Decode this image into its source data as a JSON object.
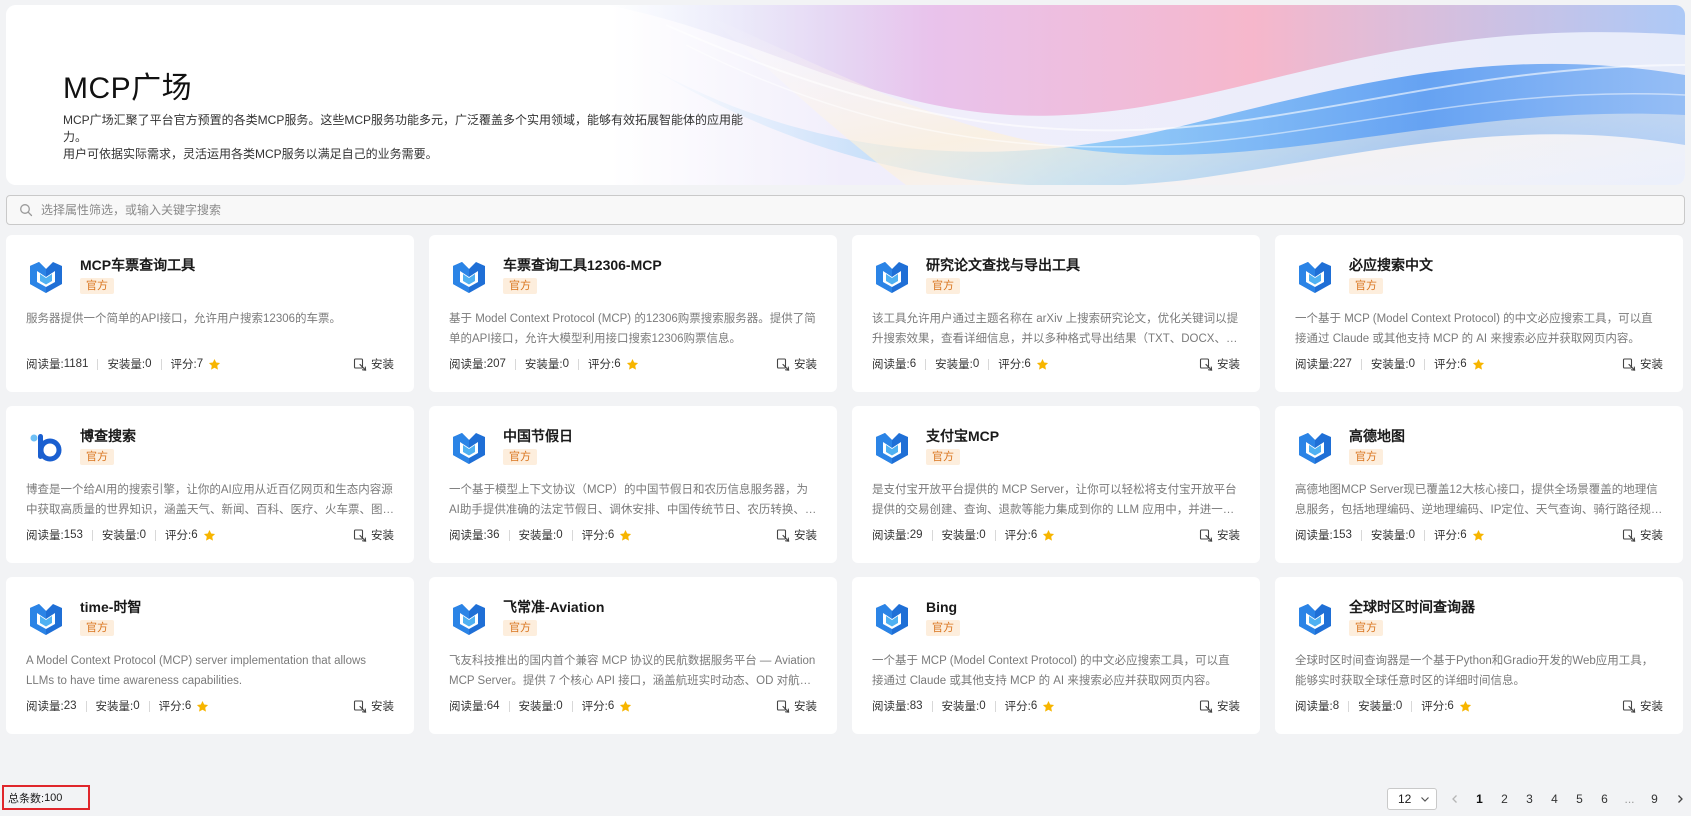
{
  "banner": {
    "title": "MCP广场",
    "desc_line1": "MCP广场汇聚了平台官方预置的各类MCP服务。这些MCP服务功能多元，广泛覆盖多个实用领域，能够有效拓展智能体的应用能力。",
    "desc_line2": "用户可依据实际需求，灵活运用各类MCP服务以满足自己的业务需要。"
  },
  "search": {
    "placeholder": "选择属性筛选，或输入关键字搜索",
    "icon": "search-icon"
  },
  "labels": {
    "reads": "阅读量: ",
    "installs": "安装量: ",
    "rating": "评分: ",
    "install_button": "安装",
    "official_badge": "官方"
  },
  "colors": {
    "badge_bg": "#fdeedd",
    "badge_text": "#d9741d",
    "logo_blue": "#1f6fd6",
    "logo_light": "#4fb1f2",
    "star": "#f7b500",
    "total_border": "#e0262b"
  },
  "cards": [
    {
      "name": "MCP车票查询工具",
      "badge": "官方",
      "logo": "mcp-logo-icon",
      "desc": "服务器提供一个简单的API接口，允许用户搜索12306的车票。",
      "reads": "1181",
      "installs": "0",
      "rating": "7"
    },
    {
      "name": "车票查询工具12306-MCP",
      "badge": "官方",
      "logo": "mcp-logo-icon",
      "desc": "基于 Model Context Protocol (MCP) 的12306购票搜索服务器。提供了简单的API接口，允许大模型利用接口搜索12306购票信息。",
      "reads": "207",
      "installs": "0",
      "rating": "6"
    },
    {
      "name": "研究论文查找与导出工具",
      "badge": "官方",
      "logo": "mcp-logo-icon",
      "desc": "该工具允许用户通过主题名称在 arXiv 上搜索研究论文，优化关键词以提升搜索效果，查看详细信息，并以多种格式导出结果（TXT、DOCX、PDF、...",
      "reads": "6",
      "installs": "0",
      "rating": "6"
    },
    {
      "name": "必应搜索中文",
      "badge": "官方",
      "logo": "mcp-logo-icon",
      "desc": "一个基于 MCP (Model Context Protocol) 的中文必应搜索工具，可以直接通过 Claude 或其他支持 MCP 的 AI 来搜索必应并获取网页内容。",
      "reads": "227",
      "installs": "0",
      "rating": "6"
    },
    {
      "name": "博查搜索",
      "badge": "官方",
      "logo": "bocha-logo-icon",
      "desc": "博查是一个给AI用的搜索引擎，让你的AI应用从近百亿网页和生态内容源中获取高质量的世界知识，涵盖天气、新闻、百科、医疗、火车票、图片等...",
      "reads": "153",
      "installs": "0",
      "rating": "6"
    },
    {
      "name": "中国节假日",
      "badge": "官方",
      "logo": "mcp-logo-icon",
      "desc": "一个基于模型上下文协议（MCP）的中国节假日和农历信息服务器，为AI助手提供准确的法定节假日、调休安排、中国传统节日、农历转换、二十四...",
      "reads": "36",
      "installs": "0",
      "rating": "6"
    },
    {
      "name": "支付宝MCP",
      "badge": "官方",
      "logo": "mcp-logo-icon",
      "desc": "是支付宝开放平台提供的 MCP Server，让你可以轻松将支付宝开放平台提供的交易创建、查询、退款等能力集成到你的 LLM 应用中，并进一步创建具...",
      "reads": "29",
      "installs": "0",
      "rating": "6"
    },
    {
      "name": "高德地图",
      "badge": "官方",
      "logo": "mcp-logo-icon",
      "desc": "高德地图MCP Server现已覆盖12大核心接口，提供全场景覆盖的地理信息服务，包括地理编码、逆地理编码、IP定位、天气查询、骑行路径规划、步行...",
      "reads": "153",
      "installs": "0",
      "rating": "6"
    },
    {
      "name": "time-时智",
      "badge": "官方",
      "logo": "mcp-logo-icon",
      "desc": "A Model Context Protocol (MCP) server implementation that allows LLMs to have time awareness capabilities.",
      "reads": "23",
      "installs": "0",
      "rating": "6"
    },
    {
      "name": "飞常准-Aviation",
      "badge": "官方",
      "logo": "mcp-logo-icon",
      "desc": "飞友科技推出的国内首个兼容 MCP 协议的民航数据服务平台 — Aviation MCP Server。提供 7 个核心 API 接口，涵盖航班实时动态、OD 对航班查...",
      "reads": "64",
      "installs": "0",
      "rating": "6"
    },
    {
      "name": "Bing",
      "badge": "官方",
      "logo": "mcp-logo-icon",
      "desc": "一个基于 MCP (Model Context Protocol) 的中文必应搜索工具，可以直接通过 Claude 或其他支持 MCP 的 AI 来搜索必应并获取网页内容。",
      "reads": "83",
      "installs": "0",
      "rating": "6"
    },
    {
      "name": "全球时区时间查询器",
      "badge": "官方",
      "logo": "mcp-logo-icon",
      "desc": "全球时区时间查询器是一个基于Python和Gradio开发的Web应用工具，能够实时获取全球任意时区的详细时间信息。",
      "reads": "8",
      "installs": "0",
      "rating": "6"
    }
  ],
  "footer": {
    "total_label": "总条数: ",
    "total_value": "100",
    "page_size": "12",
    "pages": [
      "1",
      "2",
      "3",
      "4",
      "5",
      "6"
    ],
    "ellipsis": "...",
    "last_page": "9",
    "current_page": "1"
  }
}
